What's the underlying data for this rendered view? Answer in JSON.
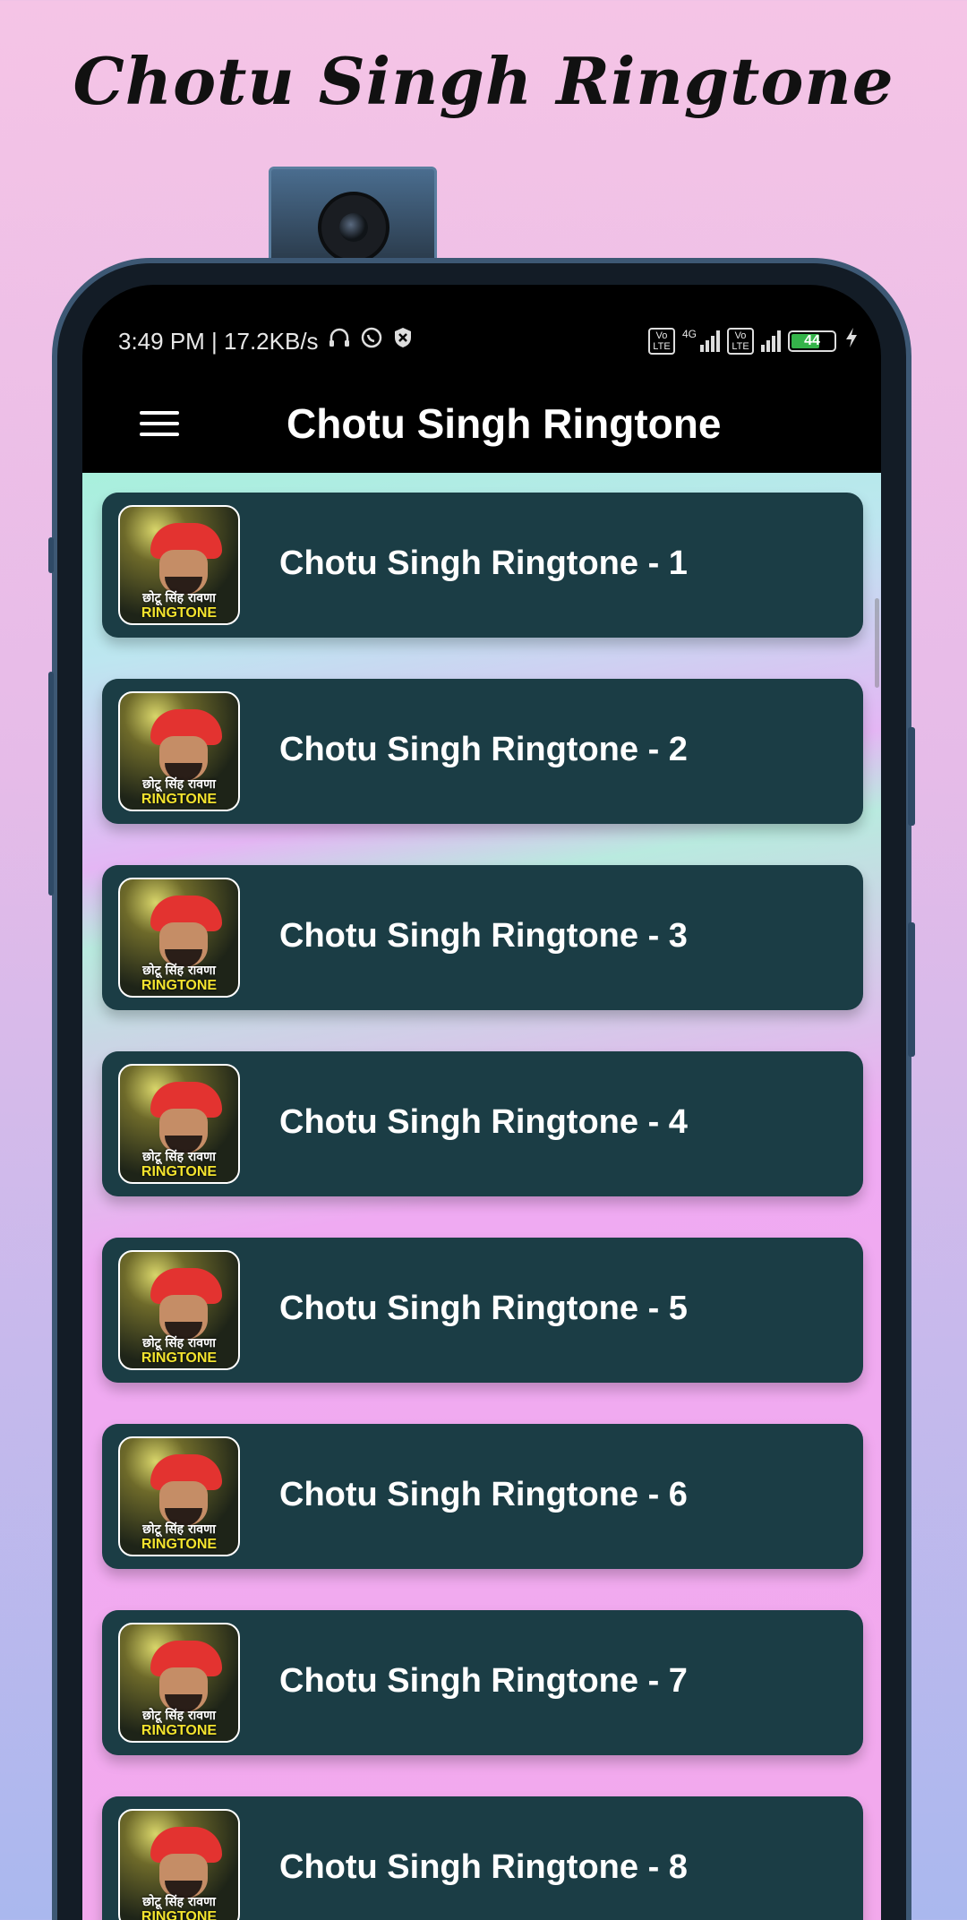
{
  "promo": {
    "title": "Chotu Singh Ringtone"
  },
  "status_bar": {
    "time_speed": "3:49 PM | 17.2KB/s",
    "volte_label": "Vo\nLTE",
    "network_4g": "4G",
    "battery": "44",
    "icons": [
      "headphones-icon",
      "whatsapp-icon",
      "shield-icon",
      "volte-icon",
      "signal-icon",
      "volte-icon",
      "signal-icon",
      "battery-icon",
      "charging-icon"
    ]
  },
  "appbar": {
    "title": "Chotu Singh Ringtone",
    "menu_icon": "hamburger-menu-icon"
  },
  "thumbnail": {
    "hindi_text": "छोटू सिंह रावणा",
    "caption": "RINGTONE"
  },
  "list": {
    "items": [
      {
        "label": "Chotu Singh Ringtone - 1"
      },
      {
        "label": "Chotu Singh Ringtone - 2"
      },
      {
        "label": "Chotu Singh Ringtone - 3"
      },
      {
        "label": "Chotu Singh Ringtone - 4"
      },
      {
        "label": "Chotu Singh Ringtone - 5"
      },
      {
        "label": "Chotu Singh Ringtone - 6"
      },
      {
        "label": "Chotu Singh Ringtone - 7"
      },
      {
        "label": "Chotu Singh Ringtone - 8"
      }
    ]
  },
  "colors": {
    "item_bg": "#1b3d45",
    "appbar_bg": "#000000",
    "thumbnail_caption": "#f3e32e"
  }
}
